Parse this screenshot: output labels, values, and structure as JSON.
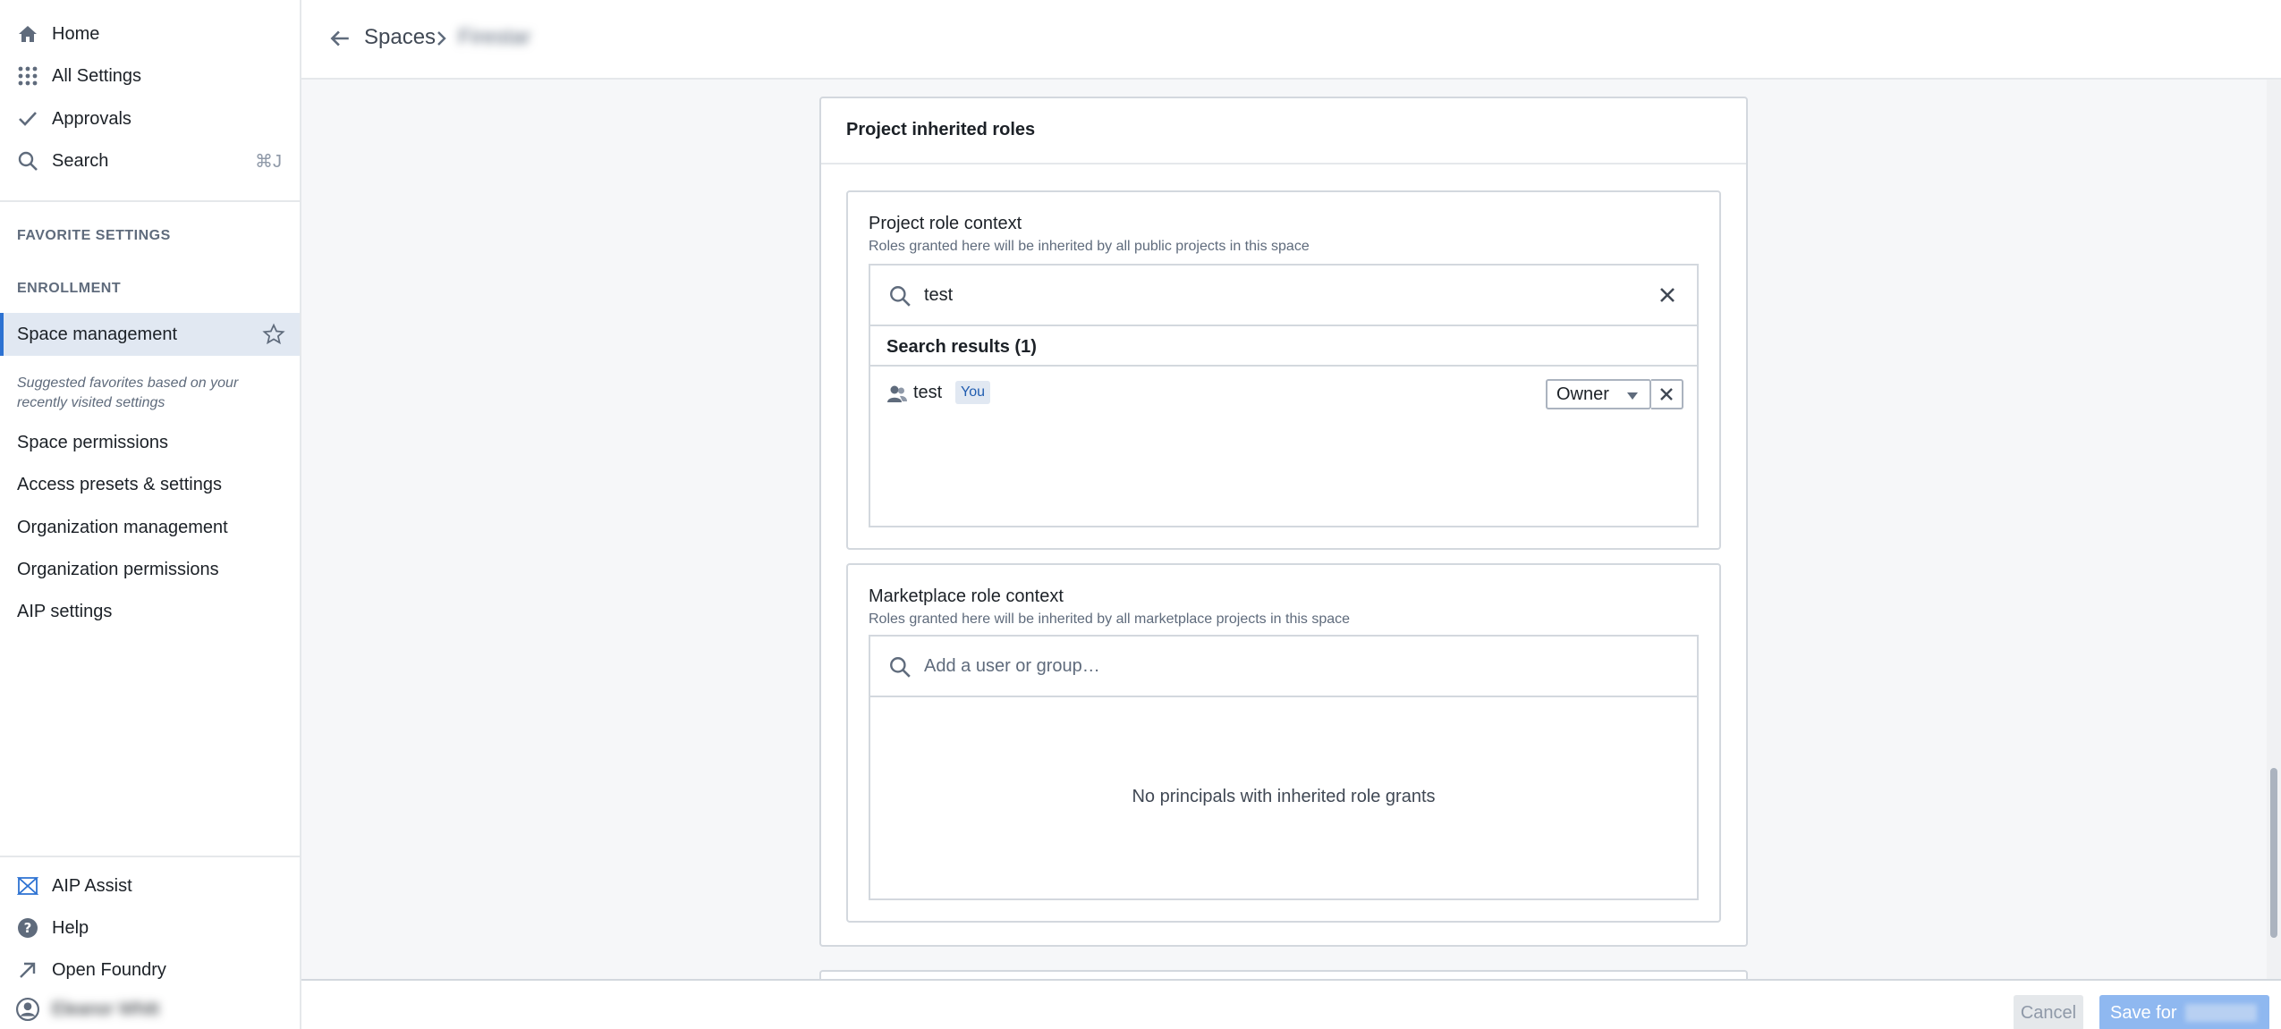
{
  "sidebar": {
    "nav": [
      {
        "label": "Home",
        "icon": "home-icon"
      },
      {
        "label": "All Settings",
        "icon": "grid-icon"
      },
      {
        "label": "Approvals",
        "icon": "check-icon"
      },
      {
        "label": "Search",
        "icon": "search-icon",
        "shortcut": "⌘J"
      }
    ],
    "favorite_heading": "FAVORITE SETTINGS",
    "enrollment_heading": "ENROLLMENT",
    "active_item": "Space management",
    "hint": "Suggested favorites based on your recently visited settings",
    "suggested": [
      "Space permissions",
      "Access presets & settings",
      "Organization management",
      "Organization permissions",
      "AIP settings"
    ],
    "bottom": [
      {
        "label": "AIP Assist",
        "icon": "aip-assist-icon"
      },
      {
        "label": "Help",
        "icon": "help-icon"
      },
      {
        "label": "Open Foundry",
        "icon": "external-arrow-icon"
      }
    ],
    "user_name": "Eleanor Whitt"
  },
  "topbar": {
    "breadcrumb_root": "Spaces",
    "breadcrumb_current": "Firestar"
  },
  "card": {
    "title": "Project inherited roles",
    "project": {
      "title": "Project role context",
      "description": "Roles granted here will be inherited by all public projects in this space",
      "search_value": "test",
      "results_heading": "Search results (1)",
      "result": {
        "name": "test",
        "tag": "You",
        "role": "Owner"
      }
    },
    "marketplace": {
      "title": "Marketplace role context",
      "description": "Roles granted here will be inherited by all marketplace projects in this space",
      "placeholder": "Add a user or group…",
      "empty": "No principals with inherited role grants"
    }
  },
  "footer": {
    "cancel": "Cancel",
    "save": "Save for"
  },
  "colors": {
    "accent": "#2d72d2",
    "active_bg": "#e1e8f2",
    "save_disabled": "#8fb8f0"
  }
}
